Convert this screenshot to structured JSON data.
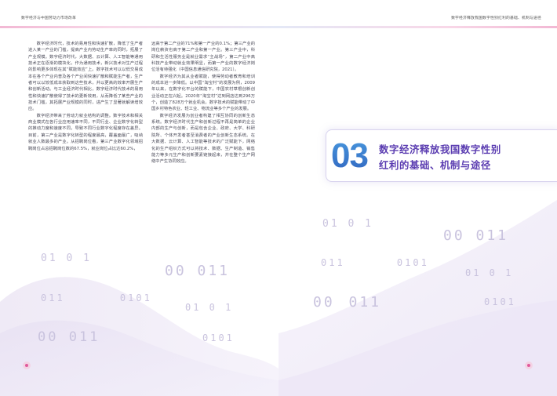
{
  "header": {
    "left_title": "数字经济与中国劳动力市场改革",
    "right_title": "数字经济释放我国数字性别红利的基础、机制与途径"
  },
  "left_page": {
    "col1": [
      "数字经济时代，技术的易用性和快速扩散，降低了生产者进入某一产业的门槛，提高产业内劳动生产率的同时，拓展了产业规模。数字经济时代，大数据、云计算、人工智能等通用技术正在逐渐的模块化，作为通用技术，新兴技术对生产过程的影响更多体现在其“赋能效应”上。数字技术可以以低交易成本在各个产业内普及各个产业间快速扩散和赋能生产者，生产者可以以较低成本获取到这些技术，并以更高的效率开展生产和创新活动。与工业经济时代相比，数字经济时代技术的易用性和快速扩散使得了技术的更新效用，从而降低了某些产业的技术门槛，其拓展产业规模的同时，进产生了显著就解读增效应。",
      "数字经济带来了劳动力就业结构的调整。数字技术和相关商业模式在各行业应用速率不同，不同行业、企业数字化转型的推动力度和速度不同，导致不同行业数字化程度存在差异。目前，第三产业是数字化转型的程度最高，覆盖面最广，吸纳就业人数最多的产业。从招聘岗位看，第三产业数字化领域招聘岗位占总招聘岗位数的67.5%，就业岗位占比达60.2%，"
    ],
    "col2": [
      "远高于第二产业的71%和第一产业的0.1%；第三产业的岗位薪资也高于第二产业和第一产业。第三产业中，科研和生活性服务业是就业需求“主战场”，第二产业中高科技产业带动就业效果明显，而第一产业的数字经济岗位活有待强化（中国信息通信研究院，2021）。",
      "数字经济为其从业者赋能，使得劳动者教育和培训的成本进一步降低。以中国“淘宝村”的发展为例，2009年以来，在数字化平台的赋能下，中国农村草根创新创业活动正在兴起。2020年“淘宝村”达到网店达到296万个，创造了828万个就业机会。数字技术的赋能带动了中国乡村特色农业、轻工业、物流业等多个产业的发展。",
      "数字经济发展为创业者构建了相互协同的创新生态系统。数字经济时代生产和创新过程不再是简单的企业内部的生产与创新，而是包含企业、政府、大学、科研院所、个体开发者甚至消费者的产业创新生态系统。在大数据、云计算、人工智能等技术的广泛赋能下，网络化的生产组织方式可以将技术、数据、生产制造、销售能力等多元生产和创新要素链接起来，并在整个生产网络中产生协同效应。"
    ],
    "binary_rows": [
      {
        "text": "01 0 1",
        "size": 13
      },
      {
        "text": "00 011",
        "size": 18
      },
      {
        "text": "011 0101",
        "size": 12
      },
      {
        "text": "01 0 1",
        "size": 12
      },
      {
        "text": "00 011",
        "size": 17
      },
      {
        "text": "0101",
        "size": 12
      }
    ]
  },
  "right_page": {
    "chapter_number": "03",
    "chapter_title_line1": "数字经济释放我国数字性别",
    "chapter_title_line2": "红利的基础、机制与途径",
    "binary_rows": [
      {
        "text": "01 0 1",
        "size": 13
      },
      {
        "text": "00 011",
        "size": 18
      },
      {
        "text": "011 0101",
        "size": 12
      },
      {
        "text": "01 0 1",
        "size": 12
      },
      {
        "text": "00 011",
        "size": 18
      },
      {
        "text": "0101",
        "size": 12
      }
    ]
  },
  "colors": {
    "accent_purple": "#5b3db1",
    "accent_blue": "#3b82cf",
    "accent_pink": "#e05a9c"
  }
}
